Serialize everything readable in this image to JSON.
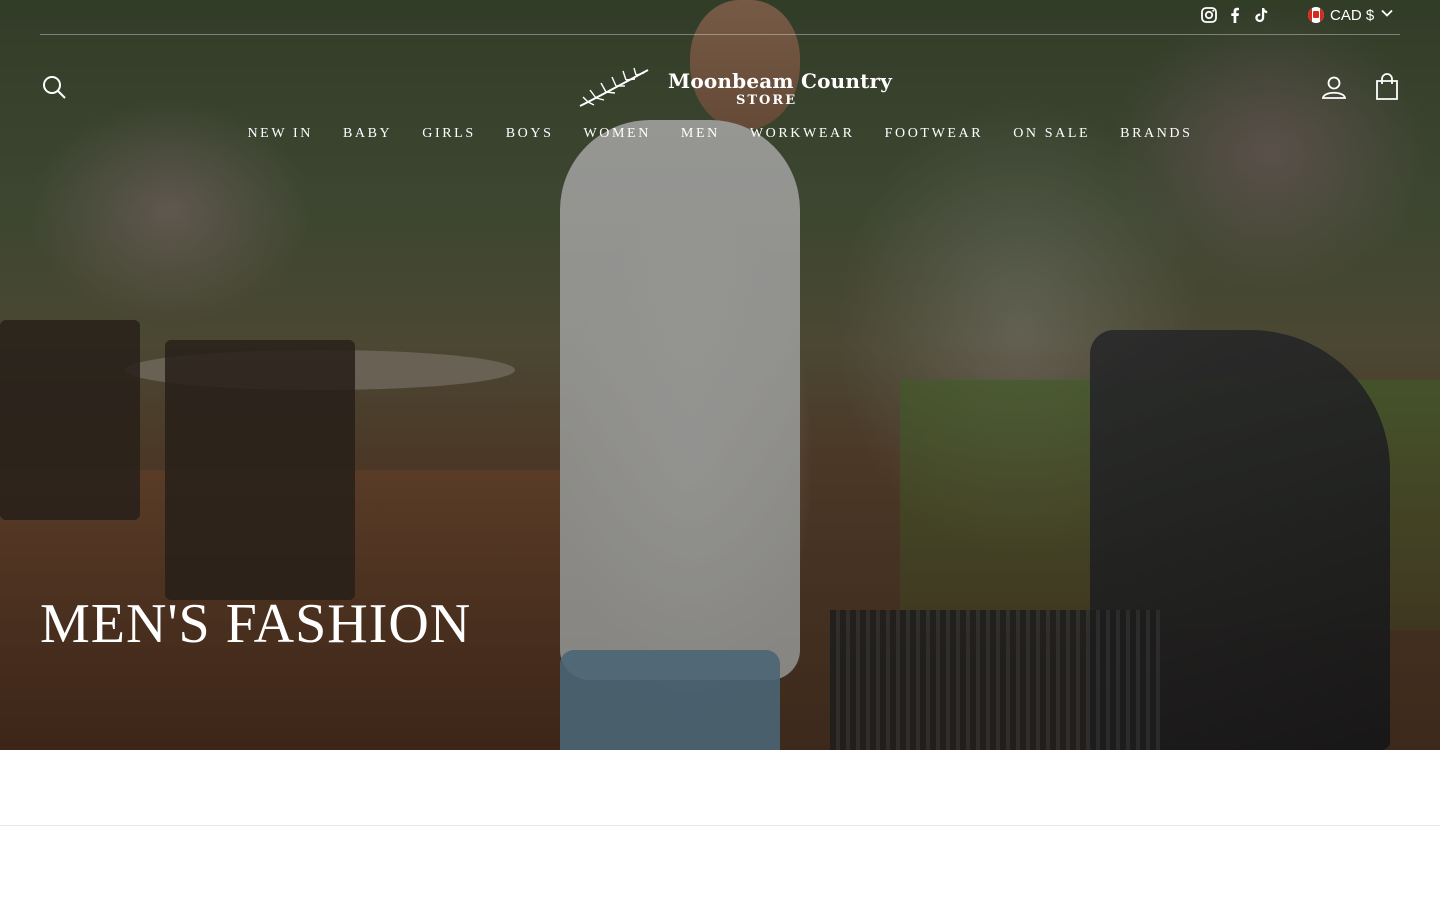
{
  "topbar": {
    "social": [
      {
        "name": "instagram-icon"
      },
      {
        "name": "facebook-icon"
      },
      {
        "name": "tiktok-icon"
      }
    ],
    "currency": {
      "label": "CAD $",
      "flag": "canada-flag-icon"
    }
  },
  "header": {
    "logo": {
      "line1": "Moonbeam Country",
      "line2": "STORE"
    },
    "search_icon": "search-icon",
    "account_icon": "user-icon",
    "cart_icon": "bag-icon"
  },
  "nav": {
    "items": [
      "NEW IN",
      "BABY",
      "GIRLS",
      "BOYS",
      "WOMEN",
      "MEN",
      "WORKWEAR",
      "FOOTWEAR",
      "ON SALE",
      "BRANDS"
    ]
  },
  "hero": {
    "title": "MEN'S FASHION",
    "image_subject": "man grilling burgers in backyard"
  },
  "colors": {
    "text_on_hero": "#ffffff",
    "page_bg": "#ffffff"
  }
}
